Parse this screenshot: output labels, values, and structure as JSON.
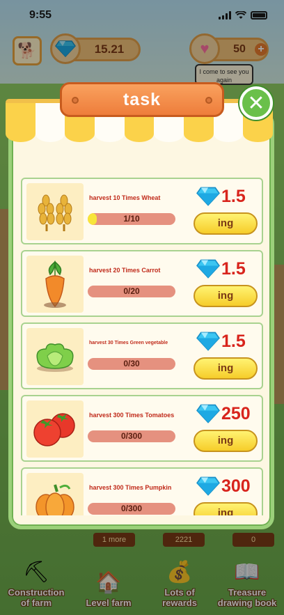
{
  "status_bar": {
    "time": "9:55"
  },
  "hud": {
    "gems": "15.21",
    "hearts": "50",
    "plus": "+",
    "tip": "I come to see you again"
  },
  "modal": {
    "title": "task",
    "close": "✕"
  },
  "tasks": [
    {
      "name": "harvest 10 Times Wheat",
      "icon": "wheat-icon",
      "progress_text": "1/10",
      "progress": 0.1,
      "reward": "1.5",
      "button": "ing"
    },
    {
      "name": "harvest 20 Times Carrot",
      "icon": "carrot-icon",
      "progress_text": "0/20",
      "progress": 0,
      "reward": "1.5",
      "button": "ing"
    },
    {
      "name": "harvest 30 Times Green vegetable",
      "icon": "cabbage-icon",
      "progress_text": "0/30",
      "progress": 0,
      "reward": "1.5",
      "button": "ing"
    },
    {
      "name": "harvest 300 Times Tomatoes",
      "icon": "tomato-icon",
      "progress_text": "0/300",
      "progress": 0,
      "reward": "250",
      "button": "ing"
    },
    {
      "name": "harvest 300 Times Pumpkin",
      "icon": "pumpkin-icon",
      "progress_text": "0/300",
      "progress": 0,
      "reward": "300",
      "button": "ing"
    }
  ],
  "bottom_nav": {
    "counters": [
      "1 more",
      "2221",
      "0"
    ],
    "items": [
      {
        "label": "Construction\nof farm",
        "icon": "shovel-icon"
      },
      {
        "label": "Level farm",
        "icon": "barn-icon"
      },
      {
        "label": "Lots of\nrewards",
        "icon": "coin-bag-icon"
      },
      {
        "label": "Treasure\ndrawing book",
        "icon": "book-icon"
      }
    ]
  },
  "colors": {
    "accent_orange": "#ee7d3b",
    "reward_red": "#d8241c",
    "panel_green": "#9bd07a",
    "awning_yellow": "#fbd24a"
  }
}
